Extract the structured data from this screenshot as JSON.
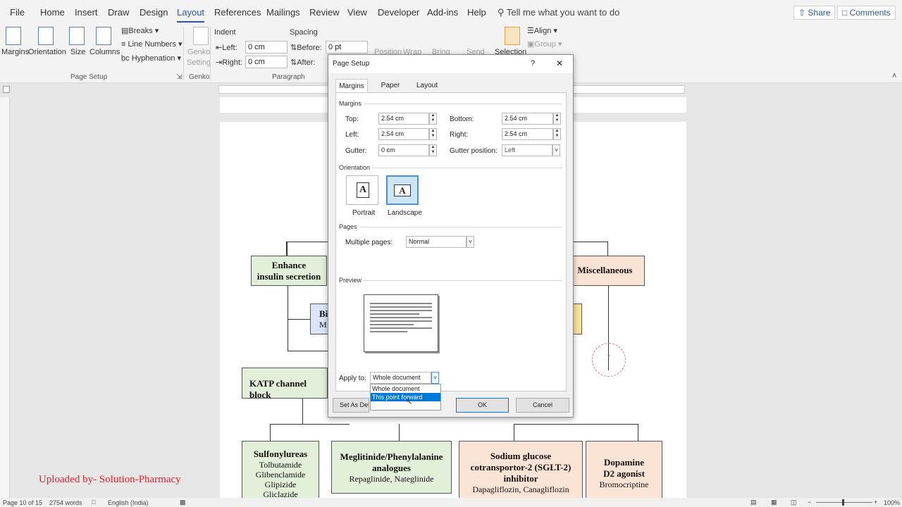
{
  "menu": {
    "items": [
      "File",
      "Home",
      "Insert",
      "Draw",
      "Design",
      "Layout",
      "References",
      "Mailings",
      "Review",
      "View",
      "Developer",
      "Add-ins",
      "Help"
    ],
    "tell_me": "Tell me what you want to do",
    "share": "Share",
    "comments": "Comments"
  },
  "ribbon": {
    "margins": "Margins",
    "orientation": "Orientation",
    "size": "Size",
    "columns": "Columns",
    "breaks": "Breaks",
    "line_numbers": "Line Numbers",
    "hyphenation": "Hyphenation",
    "page_setup_group": "Page Setup",
    "genko_btn": "Genko",
    "genko_btn2": "Setting",
    "genko_group": "Genko",
    "indent": "Indent",
    "spacing": "Spacing",
    "left_label": "Left:",
    "left_value": "0 cm",
    "right_label": "Right:",
    "right_value": "0 cm",
    "before_label": "Before:",
    "before_value": "0 pt",
    "after_label": "After:",
    "paragraph_group": "Paragraph",
    "position": "Position",
    "wrap": "Wrap",
    "bring": "Bring",
    "send": "Send",
    "selection": "Selection",
    "align": "Align",
    "group": "Group"
  },
  "document": {
    "enhance": [
      "Enhance",
      "insulin secretion"
    ],
    "misc": "Miscellaneous",
    "katp": "KATP channel block",
    "bi": "Bi",
    "bi_sub": "M",
    "sulfonylureas": "Sulfonylureas",
    "sulf_drugs": [
      "Tolbutamide",
      "Glibenclamide",
      "Glipizide",
      "Gliclazide"
    ],
    "meglitinide": [
      "Meglitinide/Phenylalanine",
      "analogues"
    ],
    "meglitinide_drugs": "Repaglinide, Nateglinide",
    "sglt2": [
      "Sodium glucose",
      "cotransportor-2 (SGLT-2)",
      "inhibitor"
    ],
    "sglt2_drugs": "Dapagliflozin, Canagliflozin",
    "dopamine": [
      "Dopamine",
      "D2 agonist"
    ],
    "dopamine_drugs": "Bromocriptine",
    "watermark": "Uploaded by- Solution-Pharmacy"
  },
  "status": {
    "page": "Page 10 of 15",
    "words": "2754 words",
    "language": "English (India)",
    "zoom": "100%"
  },
  "dialog": {
    "title": "Page Setup",
    "help": "?",
    "close": "✕",
    "tabs": [
      "Margins",
      "Paper",
      "Layout"
    ],
    "margins_section": "Margins",
    "top_label": "Top:",
    "top_value": "2.54 cm",
    "bottom_label": "Bottom:",
    "bottom_value": "2.54 cm",
    "left_label": "Left:",
    "left_value": "2.54 cm",
    "right_label": "Right:",
    "right_value": "2.54 cm",
    "gutter_label": "Gutter:",
    "gutter_value": "0 cm",
    "gutter_pos_label": "Gutter position:",
    "gutter_pos_value": "Left",
    "orientation_section": "Orientation",
    "portrait": "Portrait",
    "landscape": "Landscape",
    "pages_section": "Pages",
    "multiple_pages_label": "Multiple pages:",
    "multiple_pages_value": "Normal",
    "preview_section": "Preview",
    "apply_to_label": "Apply to:",
    "apply_to_value": "Whole document",
    "apply_options": [
      "Whole document",
      "This point forward"
    ],
    "set_default": "Set As Defa",
    "ok": "OK",
    "cancel": "Cancel"
  }
}
